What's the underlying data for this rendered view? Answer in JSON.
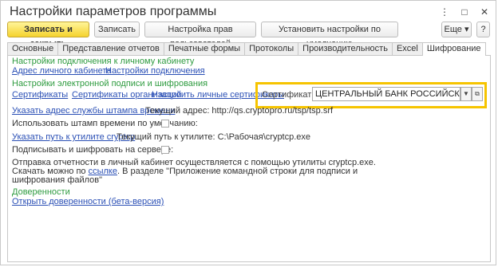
{
  "window": {
    "title": "Настройки параметров программы",
    "icons": [
      "⋮",
      "□",
      "✕"
    ]
  },
  "toolbar": {
    "save_close": "Записать и закрыть",
    "save": "Записать",
    "user_rights": "Настройка прав пользователей",
    "defaults": "Установить настройки по умолчанию",
    "more": "Еще ▾",
    "help": "?"
  },
  "tabs": [
    "Основные",
    "Представление отчетов",
    "Печатные формы",
    "Протоколы",
    "Производительность",
    "Excel",
    "Шифрование"
  ],
  "content": {
    "section1_title": "Настройки подключения к личному кабинету",
    "link_cabinet_address": "Адрес личного кабинета",
    "link_connection_settings": "Настройки подключения",
    "section2_title": "Настройки электронной подписи и шифрования",
    "link_certificates": "Сертификаты",
    "link_org_certificates": "Сертификаты организаций",
    "link_personal_certificates": "Настроить личные сертификаты",
    "cb_cert_label": "Сертификат ЦБ:",
    "cb_cert_value": "ЦЕНТРАЛЬНЫЙ БАНК РОССИЙСКОЙ ФЕДЕРАЦИИ",
    "link_timestamp": "Указать адрес службы штампа времени",
    "timestamp_current": "Текущий адрес: http://qs.cryptopro.ru/tsp/tsp.srf",
    "use_timestamp_label": "Использовать штамп времени по умолчанию:",
    "use_timestamp_checked": false,
    "link_cryptcp": "Указать путь к утилите cryptcp",
    "cryptcp_current": "Текущий путь к утилите: C:\\Рабочая\\cryptcp.exe",
    "sign_on_server_label": "Подписывать и шифровать на сервере:",
    "sign_on_server_checked": false,
    "info_line1": "Отправка отчетности в личный кабинет осуществляется с помощью утилиты cryptcp.exe.",
    "info_line2_pre": "Скачать можно по ",
    "info_line2_link": "ссылке",
    "info_line2_post": ". В разделе \"Приложение командной строки для подписи и",
    "info_line3": "шифрования файлов\"",
    "section3_title": "Доверенности",
    "link_open_poa": "Открыть доверенности (бета-версия)"
  }
}
